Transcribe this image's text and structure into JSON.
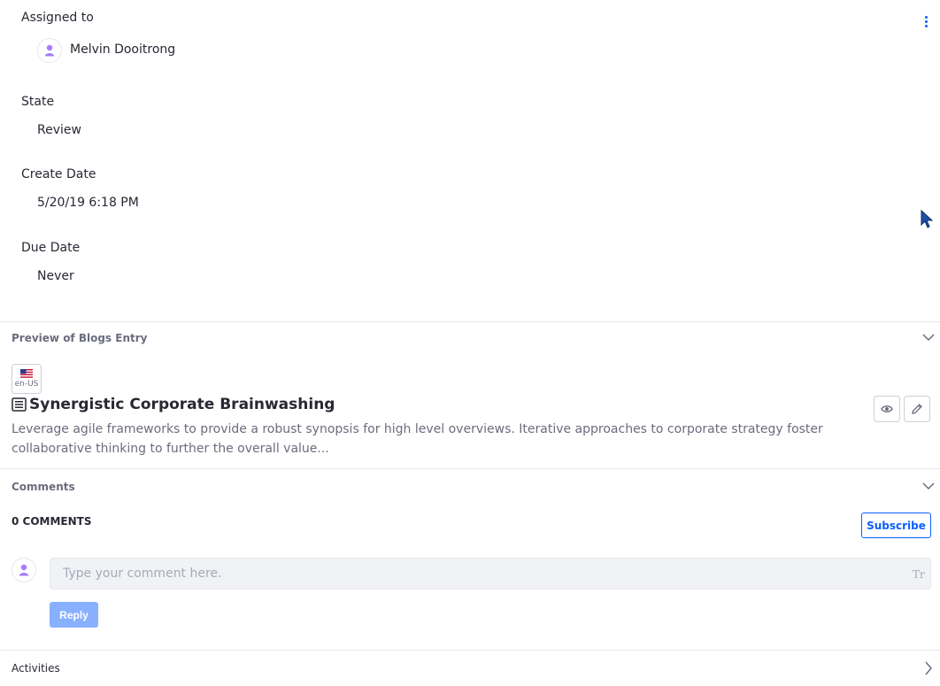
{
  "details": {
    "assigned_label": "Assigned to",
    "assignee_name": "Melvin Dooitrong",
    "state_label": "State",
    "state_value": "Review",
    "create_label": "Create Date",
    "create_value": "5/20/19 6:18 PM",
    "due_label": "Due Date",
    "due_value": "Never"
  },
  "preview": {
    "title": "Preview of Blogs Entry",
    "locale_code": "en-US",
    "entry_title": "Synergistic Corporate Brainwashing",
    "entry_description": "Leverage agile frameworks to provide a robust synopsis for high level overviews. Iterative approaches to corporate strategy foster collaborative thinking to further the overall value..."
  },
  "comments": {
    "title": "Comments",
    "count_label": "0 COMMENTS",
    "subscribe_label": "Subscribe",
    "input_placeholder": "Type your comment here.",
    "reply_label": "Reply"
  },
  "activities": {
    "title": "Activities"
  },
  "icons": {
    "kebab": "kebab-menu-icon",
    "user": "user-icon",
    "flag": "flag-us-icon",
    "blog": "blog-entry-icon",
    "view": "eye-icon",
    "edit": "pencil-icon",
    "format": "text-format-icon",
    "chevron_down": "chevron-down-icon",
    "chevron_right": "chevron-right-icon",
    "cursor": "mouse-cursor-icon"
  },
  "colors": {
    "accent": "#0b5fff",
    "avatar": "#a47bff",
    "text": "#272833",
    "muted": "#6b6c7e",
    "reply_disabled": "#89b0ff"
  }
}
